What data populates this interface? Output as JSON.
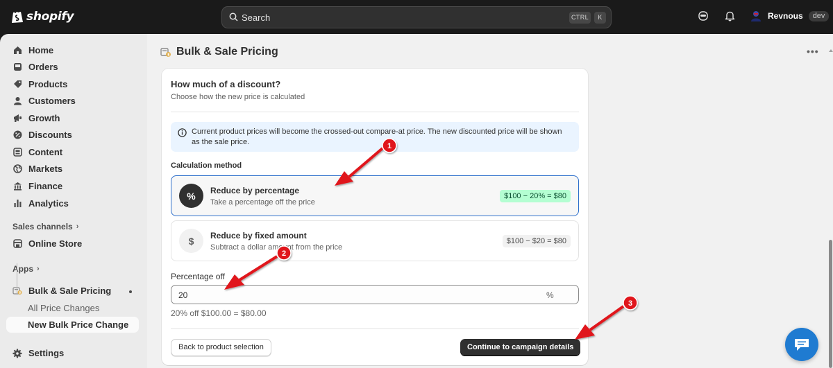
{
  "app": {
    "brand": "shopify",
    "search_placeholder": "Search",
    "shortcut_ctrl": "CTRL",
    "shortcut_key": "K",
    "user_name": "Revnous",
    "user_badge": "dev"
  },
  "sidebar": {
    "items": [
      {
        "label": "Home"
      },
      {
        "label": "Orders"
      },
      {
        "label": "Products"
      },
      {
        "label": "Customers"
      },
      {
        "label": "Growth"
      },
      {
        "label": "Discounts"
      },
      {
        "label": "Content"
      },
      {
        "label": "Markets"
      },
      {
        "label": "Finance"
      },
      {
        "label": "Analytics"
      }
    ],
    "sales_channels_label": "Sales channels",
    "online_store_label": "Online Store",
    "apps_label": "Apps",
    "app_name": "Bulk & Sale Pricing",
    "app_sub_items": [
      {
        "label": "All Price Changes"
      },
      {
        "label": "New Bulk Price Change"
      }
    ],
    "settings_label": "Settings"
  },
  "page": {
    "title": "Bulk & Sale Pricing"
  },
  "card": {
    "heading": "How much of a discount?",
    "subheading": "Choose how the new price is calculated",
    "banner_text": "Current product prices will become the crossed-out compare-at price. The new discounted price will be shown as the sale price.",
    "method_label": "Calculation method",
    "options": [
      {
        "symbol": "%",
        "title": "Reduce by percentage",
        "description": "Take a percentage off the price",
        "example": "$100 − 20% = $80",
        "selected": true
      },
      {
        "symbol": "$",
        "title": "Reduce by fixed amount",
        "description": "Subtract a dollar amount from the price",
        "example": "$100 − $20 = $80",
        "selected": false
      }
    ],
    "percentage_label": "Percentage off",
    "percentage_value": "20",
    "percentage_suffix": "%",
    "calc_preview": "20% off $100.00 = $80.00",
    "back_button": "Back to product selection",
    "continue_button": "Continue to campaign details"
  },
  "annotations": {
    "markers": [
      "1",
      "2",
      "3"
    ],
    "color": "#e0191b"
  }
}
